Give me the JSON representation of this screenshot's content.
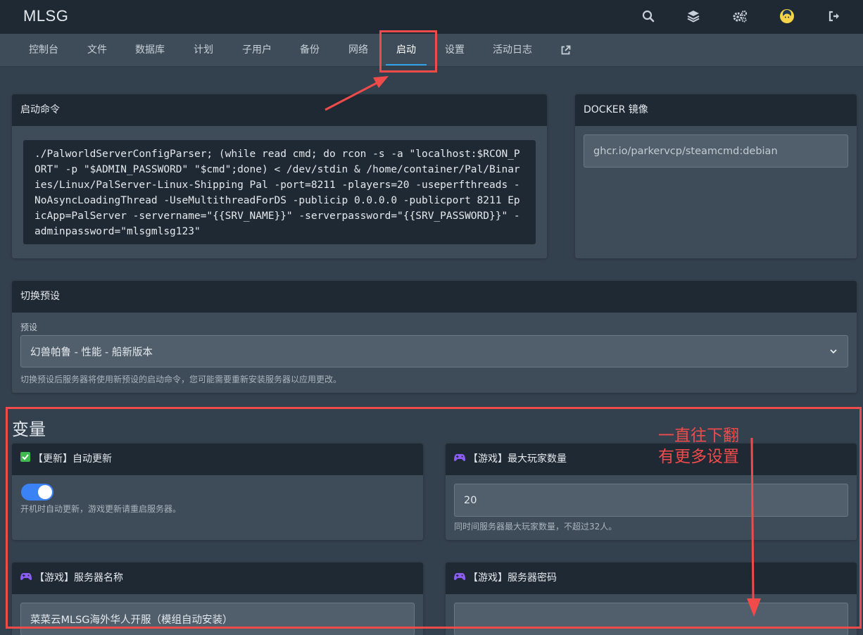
{
  "app": {
    "title": "MLSG"
  },
  "top_icons": [
    "search-icon",
    "layers-icon",
    "cogs-icon",
    "avatar-icon",
    "logout-icon"
  ],
  "nav": {
    "tabs": [
      {
        "label": "控制台"
      },
      {
        "label": "文件"
      },
      {
        "label": "数据库"
      },
      {
        "label": "计划"
      },
      {
        "label": "子用户"
      },
      {
        "label": "备份"
      },
      {
        "label": "网络"
      },
      {
        "label": "启动",
        "active": true
      },
      {
        "label": "设置"
      },
      {
        "label": "活动日志"
      }
    ],
    "external_icon": "external-link-icon"
  },
  "startup": {
    "title": "启动命令",
    "command": "./PalworldServerConfigParser; (while read cmd; do rcon -s -a \"localhost:$RCON_PORT\" -p \"$ADMIN_PASSWORD\" \"$cmd\";done) < /dev/stdin & /home/container/Pal/Binaries/Linux/PalServer-Linux-Shipping Pal -port=8211 -players=20 -useperfthreads -NoAsyncLoadingThread -UseMultithreadForDS -publicip 0.0.0.0 -publicport 8211 EpicApp=PalServer -servername=\"{{SRV_NAME}}\" -serverpassword=\"{{SRV_PASSWORD}}\" -adminpassword=\"mlsgmlsg123\""
  },
  "docker": {
    "title": "DOCKER 镜像",
    "image": "ghcr.io/parkervcp/steamcmd:debian"
  },
  "preset": {
    "title": "切换预设",
    "label": "预设",
    "selected": "幻兽帕鲁 - 性能 - 船新版本",
    "help": "切换预设后服务器将使用新预设的启动命令，您可能需要重新安装服务器以应用更改。"
  },
  "variables": {
    "title": "变量",
    "auto_update": {
      "title": "【更新】自动更新",
      "enabled": true,
      "help": "开机时自动更新，游戏更新请重启服务器。"
    },
    "max_players": {
      "title": "【游戏】最大玩家数量",
      "value": "20",
      "help": "同时间服务器最大玩家数量，不超过32人。"
    },
    "server_name": {
      "title": "【游戏】服务器名称",
      "value": "菜菜云MLSG海外华人开服（模组自动安装）"
    },
    "server_password": {
      "title": "【游戏】服务器密码",
      "value": ""
    }
  },
  "annotation": {
    "line1": "一直往下翻",
    "line2": "有更多设置"
  },
  "colors": {
    "highlight": "#ef4b4b",
    "accent": "#2fa2e8",
    "toggle_on": "#3b82f6",
    "checkbox_green": "#3fb950",
    "gamepad_purple": "#8b5cf6"
  }
}
